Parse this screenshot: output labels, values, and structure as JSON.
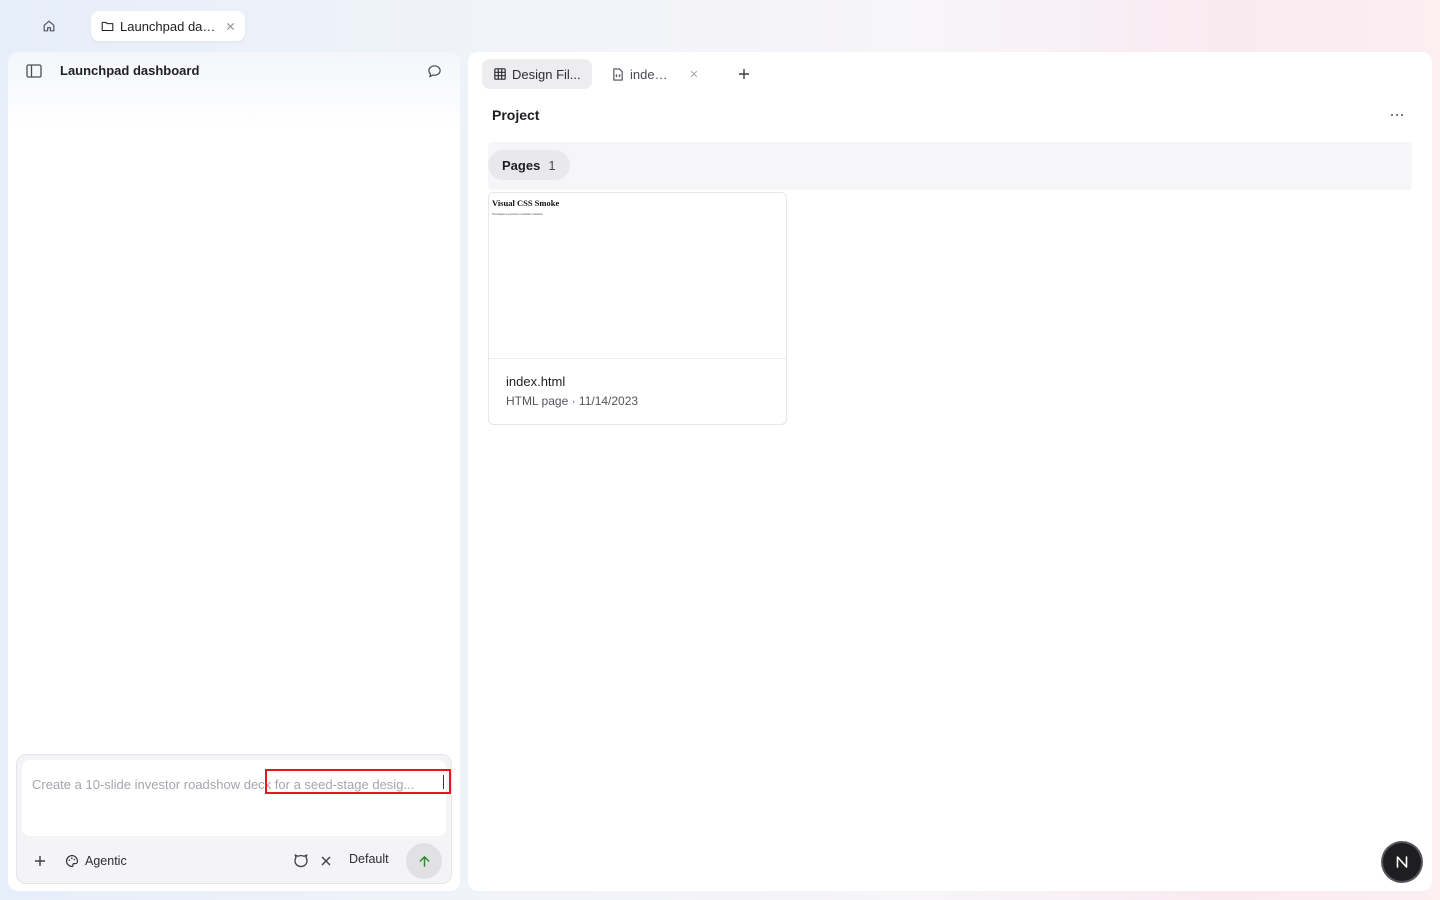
{
  "window": {
    "tab_title": "Launchpad das..."
  },
  "left": {
    "project_title": "Launchpad dashboard",
    "composer": {
      "placeholder": "Create a 10-slide investor roadshow deck for a seed-stage desig...",
      "mode_label": "Agentic",
      "model_label": "Default"
    }
  },
  "right": {
    "tabs": [
      {
        "label": "Design Fil...",
        "icon": "grid-icon",
        "active": true
      },
      {
        "label": "index....",
        "icon": "file-code-icon",
        "active": false
      }
    ],
    "section_title": "Project",
    "filter": {
      "label": "Pages",
      "count": "1"
    },
    "card": {
      "thumb_title": "Visual CSS Smoke",
      "thumb_subtitle": "Workspace preview remains framed.",
      "name": "index.html",
      "meta": "HTML page · 11/14/2023"
    }
  },
  "colors": {
    "highlight": "#e0191f",
    "send_arrow": "#2e8a2e",
    "avatar_bg": "#1e1e20"
  }
}
